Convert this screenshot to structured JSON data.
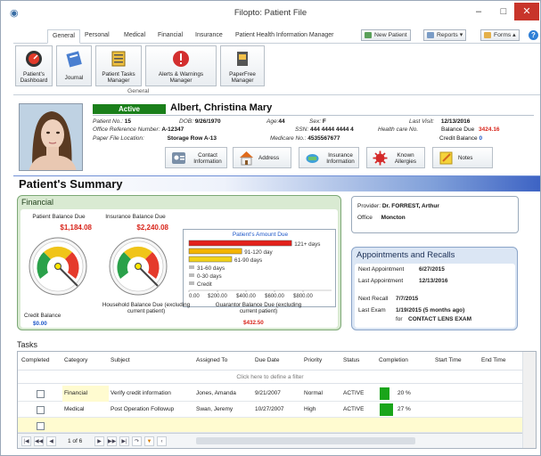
{
  "window": {
    "title": "Filopto: Patient File"
  },
  "ribbon": {
    "tabs": [
      "General",
      "Personal",
      "Medical",
      "Financial",
      "Insurance",
      "Patient Health Information Manager"
    ],
    "new_patient": "New Patient",
    "reports": "Reports",
    "forms": "Forms",
    "help": "?",
    "buttons": [
      "Patient's Dashboard",
      "Journal",
      "Patient Tasks Manager",
      "Alerts & Warnings Manager",
      "PaperFree Manager"
    ],
    "group_label": "General"
  },
  "patient": {
    "status": "Active",
    "name": "Albert, Christina Mary",
    "labels": {
      "patient_no": "Patient No.:",
      "office_ref": "Office Reference Number:",
      "paper_loc": "Paper File Location:",
      "dob": "DOB:",
      "age": "Age:",
      "sex": "Sex:",
      "ssn": "SSN:",
      "medicare": "Medicare No.:",
      "last_visit": "Last Visit:",
      "health_care": "Health care No.",
      "balance_due": "Balance Due",
      "credit_balance": "Credit Balance"
    },
    "patient_no": "15",
    "office_ref": "A-12347",
    "paper_loc": "Storage Row A-13",
    "dob": "9/26/1970",
    "age": "44",
    "sex": "F",
    "ssn": "444 4444 4444 4",
    "medicare": "4535567677",
    "last_visit": "12/13/2016",
    "balance_due": "3424.16",
    "credit_balance": "0",
    "buttons": [
      "Contact Information",
      "Address",
      "Insurance Information",
      "Known Allergies",
      "Notes"
    ]
  },
  "summary": {
    "title": "Patient's Summary"
  },
  "financial": {
    "title": "Financial",
    "patient_balance_label": "Patient Balance Due",
    "patient_balance": "$1,184.08",
    "insurance_balance_label": "Insurance Balance Due",
    "insurance_balance": "$2,240.08",
    "credit_balance_label": "Credit Balance",
    "credit_balance": "$0.00",
    "household_label": "Household Balance Due (excluding current patient)",
    "guarantor_label": "Guarantor Balance Due (excluding current patient)",
    "guarantor_balance": "$432.50",
    "colors": {
      "red": "#d8251b",
      "green": "#1a7f1a",
      "blue": "#1d57c8"
    }
  },
  "chart_data": {
    "type": "bar",
    "title": "Patient's Amount Due",
    "categories": [
      "121+ days",
      "91-120 day",
      "61-90 days",
      "31-60 days",
      "0-30 days",
      "Credit"
    ],
    "values": [
      720,
      370,
      300,
      0,
      0,
      0
    ],
    "colors": [
      "#e3211b",
      "#f4b400",
      "#f2d21a",
      "#bbbbbb",
      "#bbbbbb",
      "#bbbbbb"
    ],
    "xlim": [
      0,
      1000
    ],
    "ticks": [
      "0.00",
      "$200.00",
      "$400.00",
      "$600.00",
      "$800.00"
    ]
  },
  "provider": {
    "provider_label": "Provider:",
    "provider": "Dr. FORREST, Arthur",
    "office_label": "Office",
    "office": "Moncton"
  },
  "appointments": {
    "title": "Appointments and Recalls",
    "next_appt_label": "Next Appointment",
    "next_appt": "6/27/2015",
    "last_appt_label": "Last Appointment",
    "last_appt": "12/13/2016",
    "next_recall_label": "Next Recall",
    "next_recall": "7/7/2015",
    "last_exam_label": "Last Exam",
    "last_exam": "1/19/2015 (5 months ago)",
    "for_label": "for",
    "exam_type": "CONTACT LENS EXAM"
  },
  "tasks": {
    "title": "Tasks",
    "columns": [
      "Completed",
      "Category",
      "Subject",
      "Assigned To",
      "Due Date",
      "Priority",
      "Status",
      "Completion",
      "Start Time",
      "End Time"
    ],
    "filter_text": "Click here to define a filter",
    "rows": [
      {
        "category": "Financial",
        "subject": "Verify credit information",
        "assigned": "Jones, Amanda",
        "due": "9/21/2007",
        "priority": "Normal",
        "status": "ACTIVE",
        "completion": "20 %",
        "completion_value": 0.2
      },
      {
        "category": "Medical",
        "subject": "Post Operation Followup",
        "assigned": "Swan, Jeremy",
        "due": "10/27/2007",
        "priority": "High",
        "status": "ACTIVE",
        "completion": "27 %",
        "completion_value": 0.27
      }
    ],
    "pager": "1 of 6"
  }
}
